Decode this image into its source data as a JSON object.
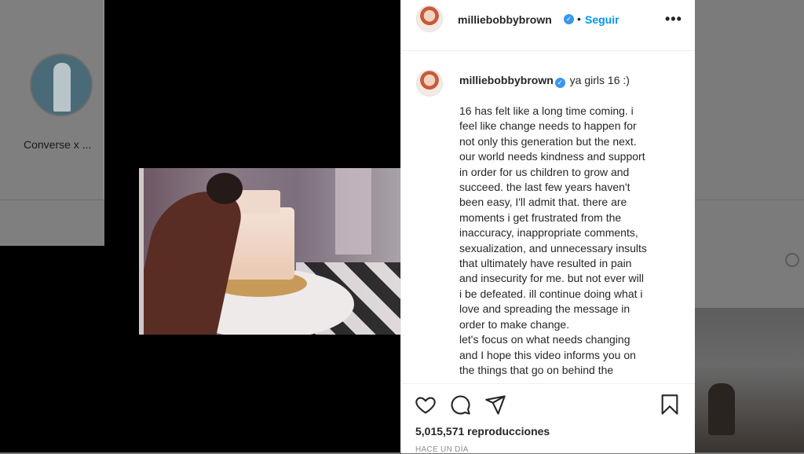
{
  "background": {
    "highlight_label": "Converse x ..."
  },
  "post": {
    "header": {
      "username": "milliebobbybrown",
      "verified_mark": "✓",
      "separator": "•",
      "follow_label": "Seguir",
      "more_label": "•••"
    },
    "caption": {
      "username": "milliebobbybrown",
      "title": "ya girls 16 :)",
      "lines": [
        "16 has felt like a long time coming. i",
        "feel like change needs to happen for",
        "not only this generation but the next.",
        "our world needs kindness and support",
        "in order for us children to grow and",
        "succeed. the last few years haven't",
        "been easy, I'll admit that. there are",
        "moments i get frustrated from the",
        "inaccuracy, inappropriate comments,",
        "sexualization, and unnecessary insults",
        "that ultimately have resulted in pain",
        "and insecurity for me. but not ever will",
        "i be defeated. ill continue doing what i",
        "love and spreading the message in",
        "order to make change.",
        "let's focus on what needs changing",
        "and I hope this video informs you on",
        "the things that go on behind the"
      ]
    },
    "actions": {
      "like_icon": "heart-icon",
      "comment_icon": "comment-icon",
      "share_icon": "paper-plane-icon",
      "save_icon": "bookmark-icon"
    },
    "views": "5,015,571 reproducciones",
    "timestamp": "HACE UN DÍA"
  },
  "colors": {
    "accent": "#0095f6",
    "verified": "#3897f0",
    "text": "#262626",
    "muted": "#8e8e8e"
  }
}
